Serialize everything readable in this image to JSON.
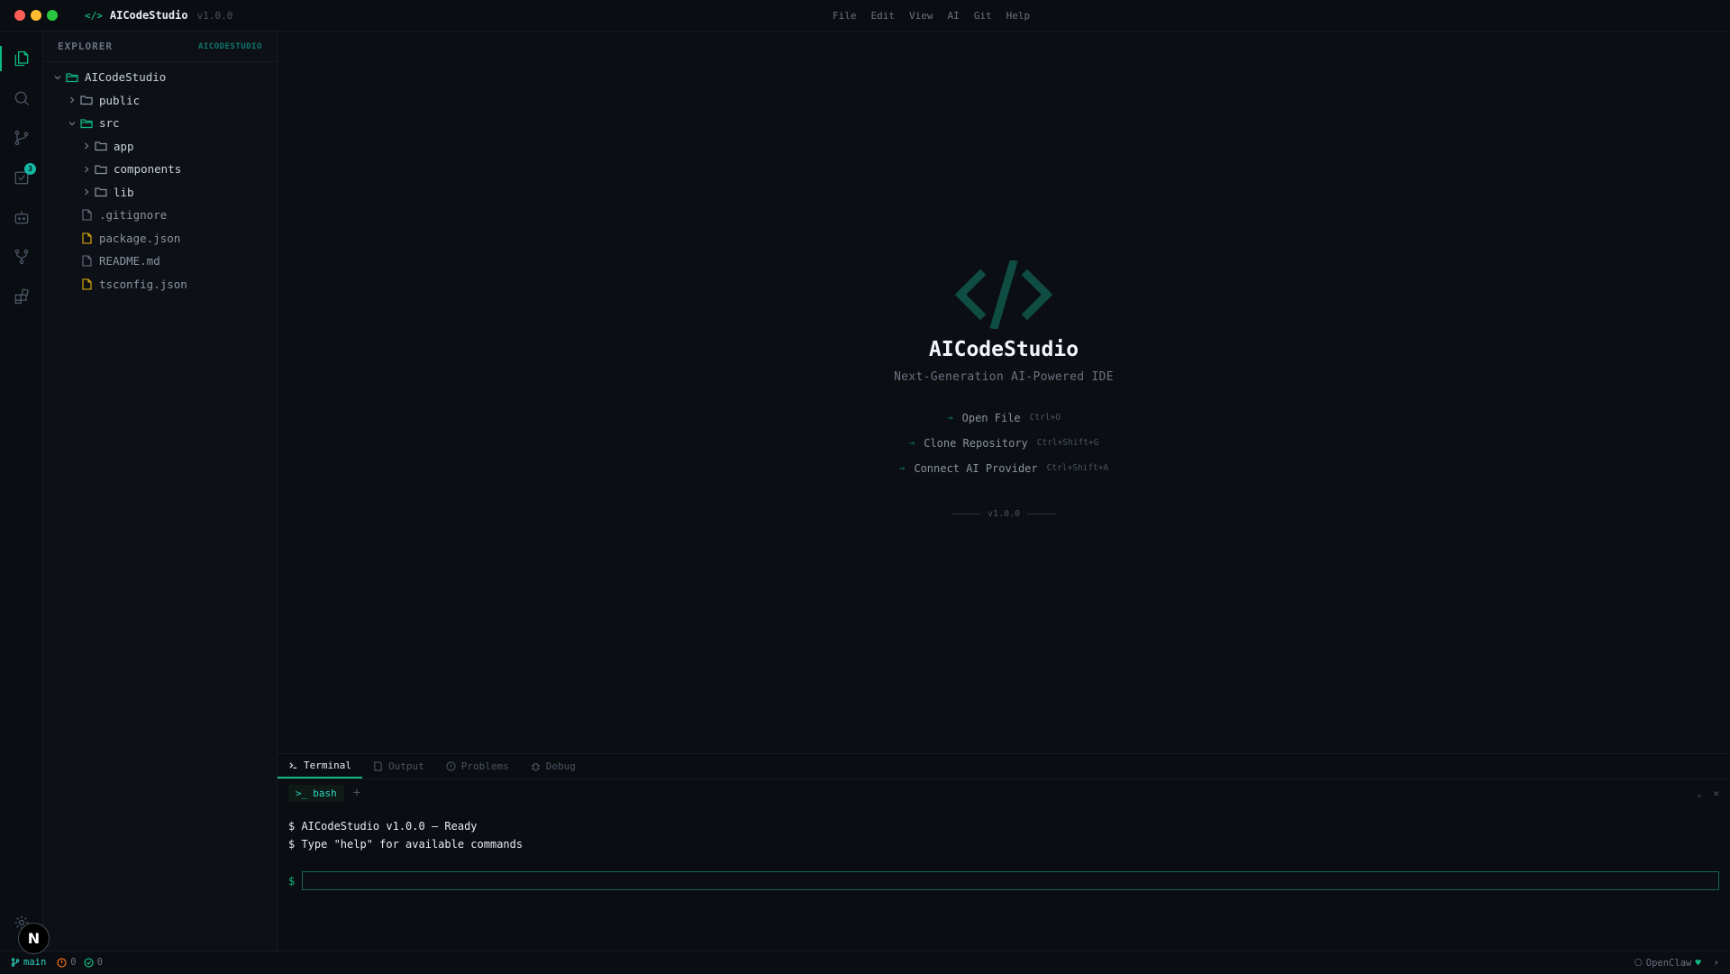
{
  "window": {
    "app_name": "AICodeStudio",
    "version": "v1.0.0",
    "menu": [
      "File",
      "Edit",
      "View",
      "AI",
      "Git",
      "Help"
    ]
  },
  "activity_bar": {
    "items": [
      {
        "name": "explorer-icon",
        "active": true
      },
      {
        "name": "search-icon"
      },
      {
        "name": "source-control-icon"
      },
      {
        "name": "tasks-icon",
        "badge": "3"
      },
      {
        "name": "ai-bot-icon"
      },
      {
        "name": "git-graph-icon"
      },
      {
        "name": "extensions-icon"
      }
    ],
    "settings_icon": "gear-icon",
    "avatar_letter": "N"
  },
  "explorer": {
    "title": "EXPLORER",
    "project_label": "AICODESTUDIO",
    "tree": [
      {
        "label": "AICodeStudio",
        "type": "folder",
        "open": true,
        "depth": 0
      },
      {
        "label": "public",
        "type": "folder",
        "open": false,
        "depth": 1
      },
      {
        "label": "src",
        "type": "folder",
        "open": true,
        "depth": 1
      },
      {
        "label": "app",
        "type": "folder",
        "open": false,
        "depth": 2
      },
      {
        "label": "components",
        "type": "folder",
        "open": false,
        "depth": 2
      },
      {
        "label": "lib",
        "type": "folder",
        "open": false,
        "depth": 2
      },
      {
        "label": ".gitignore",
        "type": "file",
        "depth": 1
      },
      {
        "label": "package.json",
        "type": "json",
        "depth": 1
      },
      {
        "label": "README.md",
        "type": "file",
        "depth": 1
      },
      {
        "label": "tsconfig.json",
        "type": "json",
        "depth": 1
      }
    ]
  },
  "welcome": {
    "logo_icon": "code-brackets-icon",
    "title": "AICodeStudio",
    "subtitle": "Next-Generation AI-Powered IDE",
    "actions": [
      {
        "label": "Open File",
        "shortcut": "Ctrl+O"
      },
      {
        "label": "Clone Repository",
        "shortcut": "Ctrl+Shift+G"
      },
      {
        "label": "Connect AI Provider",
        "shortcut": "Ctrl+Shift+A"
      }
    ],
    "version": "v1.0.0"
  },
  "panel": {
    "tabs": [
      {
        "label": "Terminal",
        "icon": "terminal-icon",
        "active": true
      },
      {
        "label": "Output",
        "icon": "output-icon"
      },
      {
        "label": "Problems",
        "icon": "problems-icon"
      },
      {
        "label": "Debug",
        "icon": "debug-icon"
      }
    ],
    "terminal_tab": "bash",
    "output_lines": [
      "$ AICodeStudio v1.0.0 — Ready",
      "$ Type \"help\" for available commands"
    ],
    "prompt": "$",
    "input_value": ""
  },
  "status_bar": {
    "branch": "main",
    "errors": "0",
    "warnings": "0",
    "right_label": "OpenClaw",
    "colors": {
      "accent": "#10b981",
      "teal": "#2dd4bf"
    }
  }
}
